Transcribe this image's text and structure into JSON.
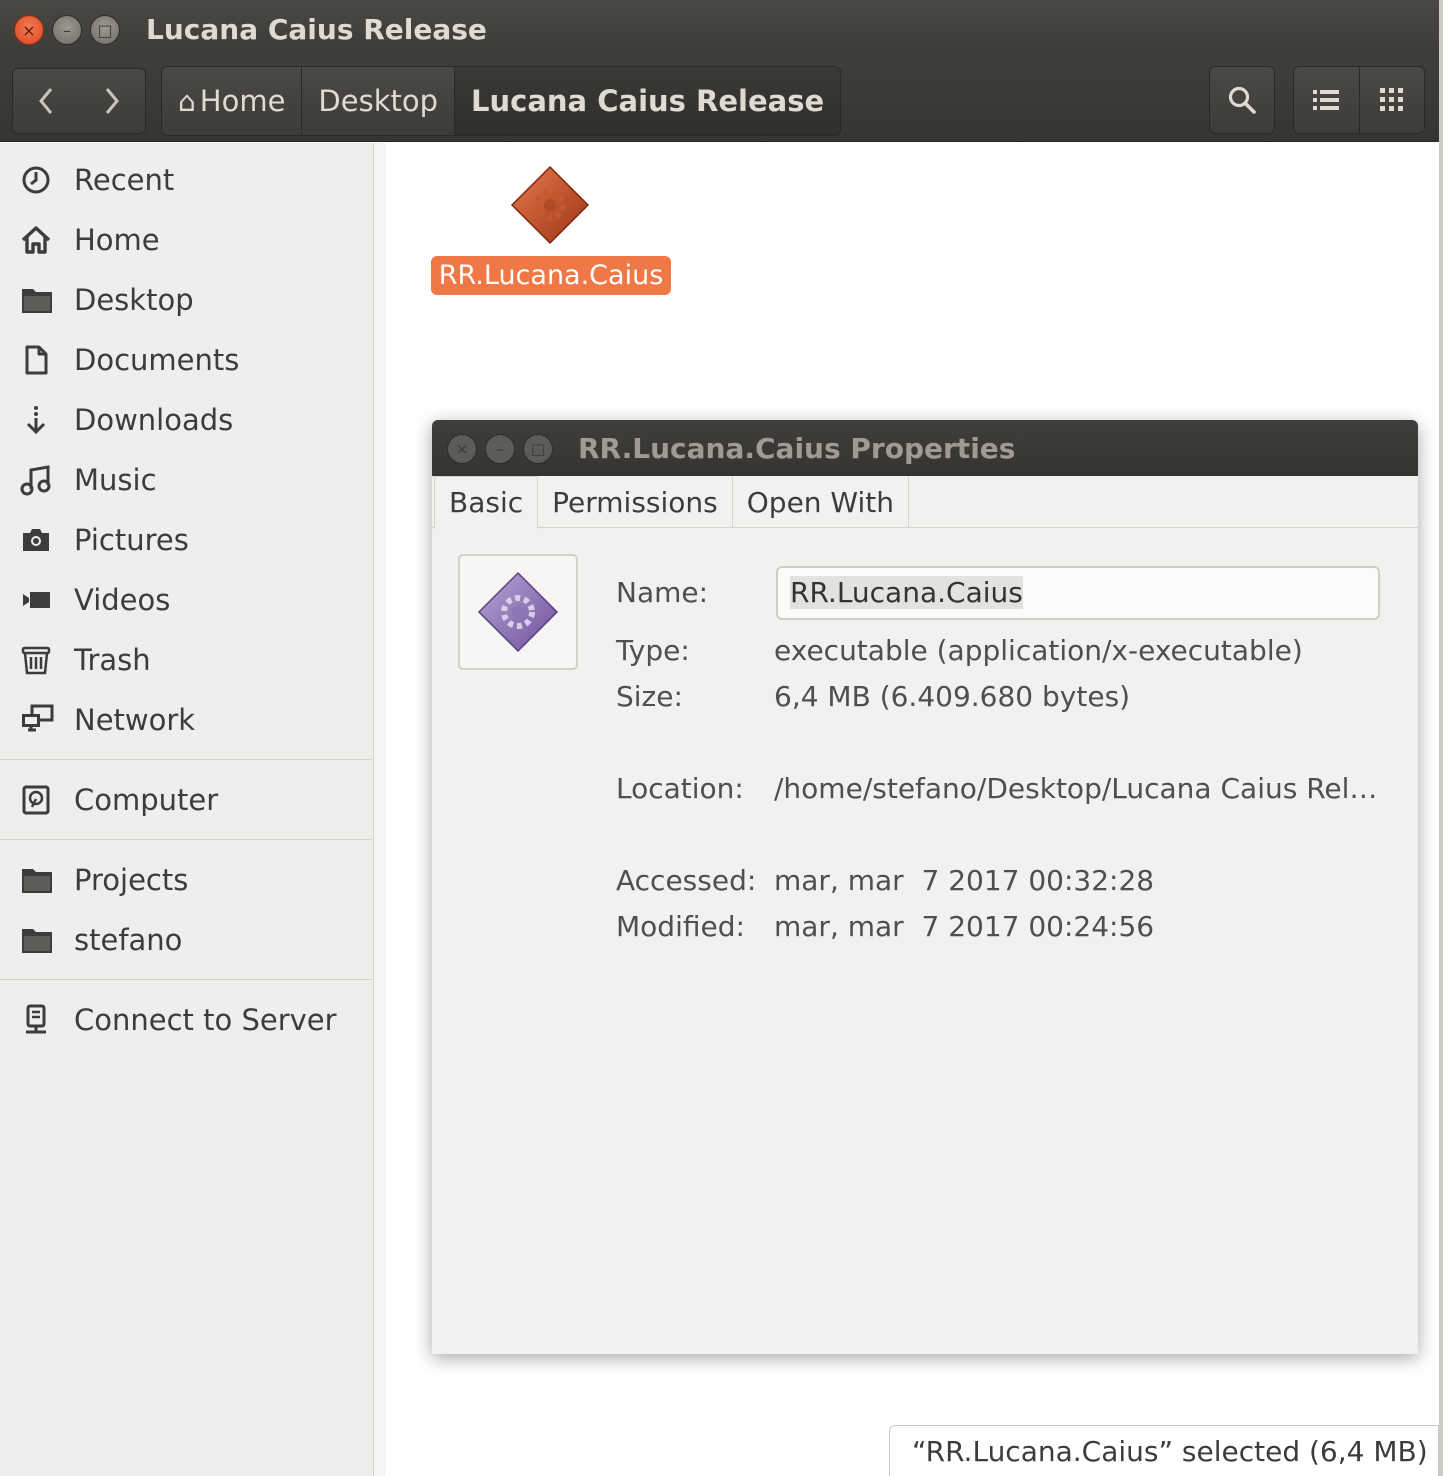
{
  "window": {
    "title": "Lucana Caius Release",
    "close_glyph": "×",
    "min_glyph": "–",
    "max_glyph": "□"
  },
  "toolbar": {
    "back_glyph": "‹",
    "forward_glyph": "›",
    "breadcrumbs": [
      "Home",
      "Desktop",
      "Lucana Caius Release"
    ],
    "home_icon_glyph": "⌂",
    "search_icon": "search-icon",
    "list_view_icon": "list-view-icon",
    "grid_view_icon": "grid-view-icon"
  },
  "sidebar": {
    "places": [
      {
        "label": "Recent",
        "icon": "clock-icon"
      },
      {
        "label": "Home",
        "icon": "home-icon"
      },
      {
        "label": "Desktop",
        "icon": "folder-icon"
      },
      {
        "label": "Documents",
        "icon": "document-icon"
      },
      {
        "label": "Downloads",
        "icon": "download-icon"
      },
      {
        "label": "Music",
        "icon": "music-icon"
      },
      {
        "label": "Pictures",
        "icon": "camera-icon"
      },
      {
        "label": "Videos",
        "icon": "video-icon"
      },
      {
        "label": "Trash",
        "icon": "trash-icon"
      },
      {
        "label": "Network",
        "icon": "network-icon"
      }
    ],
    "devices": [
      {
        "label": "Computer",
        "icon": "drive-icon"
      }
    ],
    "bookmarks": [
      {
        "label": "Projects",
        "icon": "folder-icon"
      },
      {
        "label": "stefano",
        "icon": "folder-icon"
      }
    ],
    "other": [
      {
        "label": "Connect to Server",
        "icon": "server-icon"
      }
    ]
  },
  "content": {
    "file_name": "RR.Lucana.Caius",
    "file_icon": "executable-icon"
  },
  "dialog": {
    "title": "RR.Lucana.Caius Properties",
    "close_glyph": "×",
    "min_glyph": "–",
    "max_glyph": "□",
    "tabs": [
      "Basic",
      "Permissions",
      "Open With"
    ],
    "active_tab": "Basic",
    "name_label": "Name:",
    "name_value": "RR.Lucana.Caius",
    "type_label": "Type:",
    "type_value": "executable (application/x-executable)",
    "size_label": "Size:",
    "size_value": "6,4 MB (6.409.680 bytes)",
    "location_label": "Location:",
    "location_value": "/home/stefano/Desktop/Lucana Caius Rel…",
    "accessed_label": "Accessed:",
    "accessed_value": "mar, mar  7 2017 00:32:28",
    "modified_label": "Modified:",
    "modified_value": "mar, mar  7 2017 00:24:56"
  },
  "status": {
    "text": "“RR.Lucana.Caius” selected  (6,4 MB)"
  },
  "colors": {
    "accent": "#f07746",
    "titlebar": "#3c3b37",
    "sidebar_bg": "#efeeec"
  }
}
